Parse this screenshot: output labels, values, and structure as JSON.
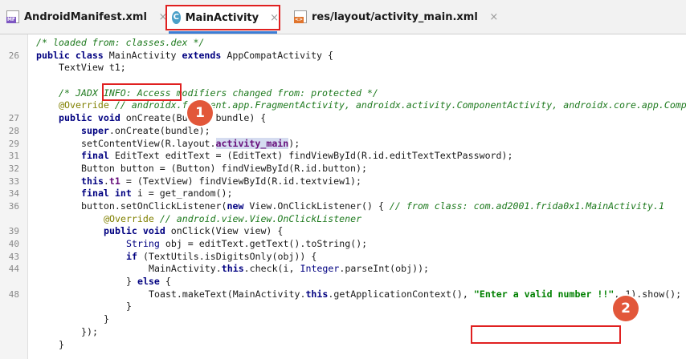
{
  "tabs": [
    {
      "label": "AndroidManifest.xml",
      "icon": "manifest-file-icon",
      "icon_text": "MF"
    },
    {
      "label": "MainActivity",
      "icon": "class-file-icon",
      "icon_text": "C"
    },
    {
      "label": "res/layout/activity_main.xml",
      "icon": "xml-file-icon",
      "icon_text": "<>"
    }
  ],
  "close_glyph": "×",
  "code_lines": [
    {
      "n": "",
      "t": "/* loaded from: classes.dex */"
    },
    {
      "n": "26",
      "t": "public class MainActivity extends AppCompatActivity {"
    },
    {
      "n": "",
      "t": "TextView t1;"
    },
    {
      "n": "",
      "t": ""
    },
    {
      "n": "",
      "t": "/* JADX INFO: Access modifiers changed from: protected */"
    },
    {
      "n": "",
      "t": "@Override // androidx.fragment.app.FragmentActivity, androidx.activity.ComponentActivity, androidx.core.app.Comp"
    },
    {
      "n": "27",
      "t": "public void onCreate(Bundle bundle) {"
    },
    {
      "n": "28",
      "t": "super.onCreate(bundle);"
    },
    {
      "n": "29",
      "t": "setContentView(R.layout.activity_main);"
    },
    {
      "n": "31",
      "t": "final EditText editText = (EditText) findViewById(R.id.editTextTextPassword);"
    },
    {
      "n": "32",
      "t": "Button button = (Button) findViewById(R.id.button);"
    },
    {
      "n": "33",
      "t": "this.t1 = (TextView) findViewById(R.id.textview1);"
    },
    {
      "n": "34",
      "t": "final int i = get_random();"
    },
    {
      "n": "36",
      "t": "button.setOnClickListener(new View.OnClickListener() { // from class: com.ad2001.frida0x1.MainActivity.1"
    },
    {
      "n": "",
      "t": "@Override // android.view.View.OnClickListener"
    },
    {
      "n": "39",
      "t": "public void onClick(View view) {"
    },
    {
      "n": "40",
      "t": "String obj = editText.getText().toString();"
    },
    {
      "n": "43",
      "t": "if (TextUtils.isDigitsOnly(obj)) {"
    },
    {
      "n": "44",
      "t": "MainActivity.this.check(i, Integer.parseInt(obj));"
    },
    {
      "n": "",
      "t": "} else {"
    },
    {
      "n": "48",
      "t": "Toast.makeText(MainActivity.this.getApplicationContext(), \"Enter a valid number !!\", 1).show();"
    },
    {
      "n": "",
      "t": "}"
    },
    {
      "n": "",
      "t": "}"
    },
    {
      "n": "",
      "t": "});"
    },
    {
      "n": "",
      "t": "}"
    }
  ],
  "callouts": {
    "one": "1",
    "two": "2"
  },
  "colors": {
    "highlight_box": "#e02020",
    "badge": "#e2573a",
    "active_tab_underline": "#3c7dd6"
  }
}
